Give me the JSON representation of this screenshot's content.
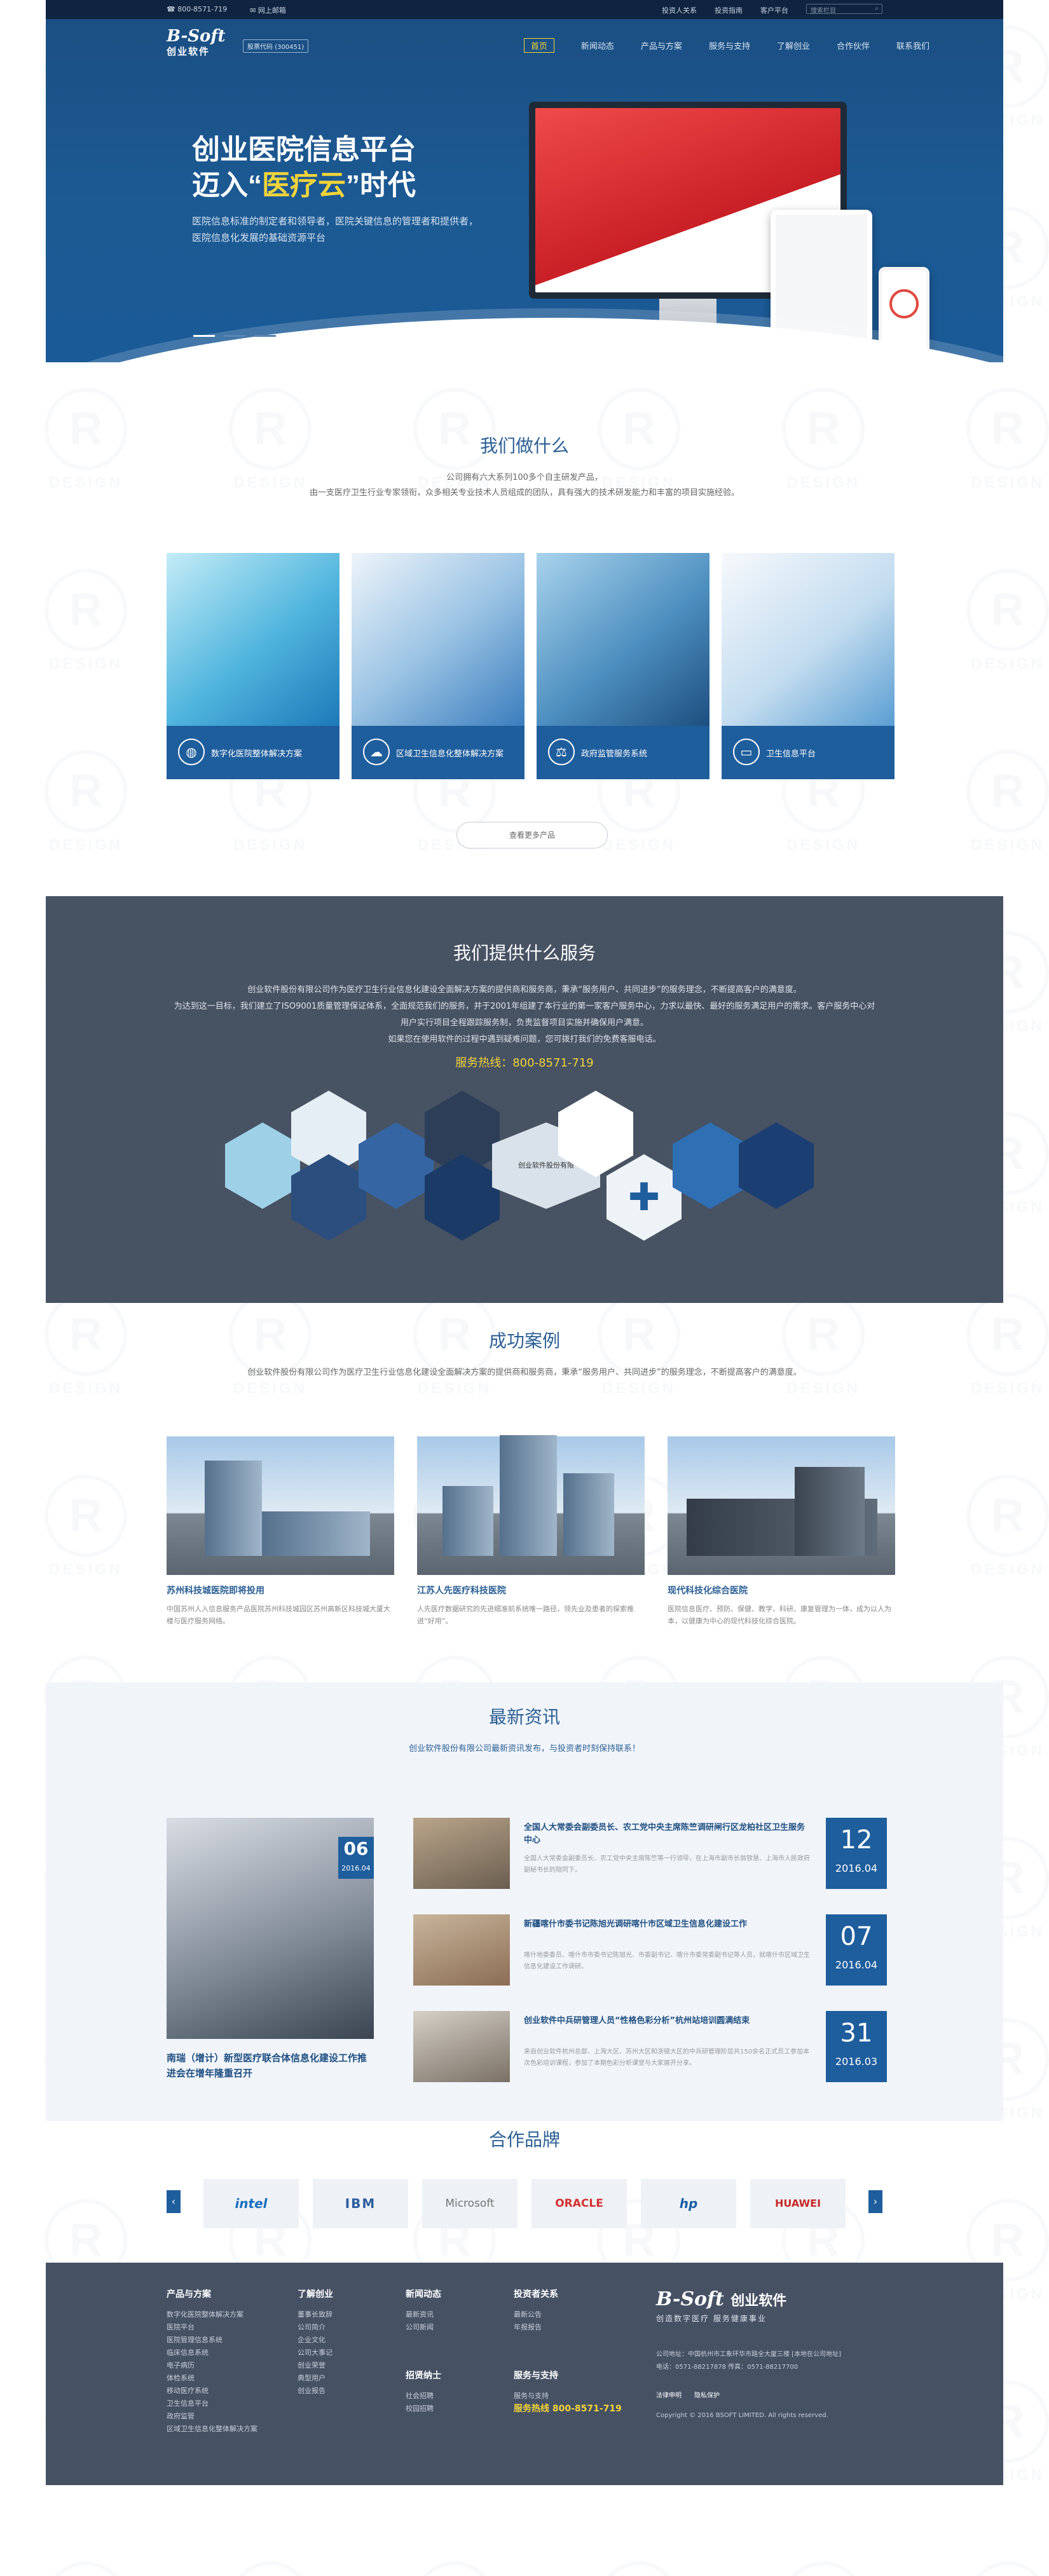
{
  "topbar": {
    "phone": "800-8571-719",
    "webmail": "网上邮箱",
    "links": [
      "投资人关系",
      "投资指南",
      "客户平台"
    ],
    "search_placeholder": "搜索栏目"
  },
  "nav": {
    "logo_script": "B-Soft",
    "logo_cn": "创业软件",
    "stock_code": "股票代码 (300451)",
    "items": [
      "首页",
      "新闻动态",
      "产品与方案",
      "服务与支持",
      "了解创业",
      "合作伙伴",
      "联系我们"
    ]
  },
  "hero": {
    "line1": "创业医院信息平台",
    "line2_pre": "迈入“",
    "line2_hl": "医疗云",
    "line2_post": "”时代",
    "desc": "医院信息标准的制定者和领导者，医院关键信息的管理者和提供者，医院信息化发展的基础资源平台"
  },
  "what_we_do": {
    "title": "我们做什么",
    "sub1": "公司拥有六大系列100多个自主研发产品，",
    "sub2": "由一支医疗卫生行业专家领衔，众多相关专业技术人员组成的团队，具有强大的技术研发能力和丰富的项目实施经验。",
    "products": [
      {
        "label": "数字化医院整体解决方案",
        "icon": "globe-icon"
      },
      {
        "label": "区域卫生信息化整体解决方案",
        "icon": "cloud-plus-icon"
      },
      {
        "label": "政府监管服务系统",
        "icon": "scales-icon"
      },
      {
        "label": "卫生信息平台",
        "icon": "monitor-network-icon"
      }
    ],
    "more_button": "查看更多产品"
  },
  "services": {
    "title": "我们提供什么服务",
    "body1": "创业软件股份有限公司作为医疗卫生行业信息化建设全面解决方案的提供商和服务商，秉承“服务用户、共同进步”的服务理念，不断提高客户的满意度。",
    "body2": "为达到这一目标，我们建立了ISO9001质量管理保证体系，全面规范我们的服务，并于2001年组建了本行业的第一家客户服务中心，力求以最快、最好的服务满足用户的需求。客户服务中心对用户实行项目全程跟踪服务制，负责监督项目实施并确保用户满意。",
    "body3": "如果您在使用软件的过程中遇到疑难问题，您可拨打我们的免费客服电话。",
    "hotline_label": "服务热线：",
    "hotline": "800-8571-719",
    "hex_text": "创业软件股份有限"
  },
  "cases": {
    "title": "成功案例",
    "sub": "创业软件股份有限公司作为医疗卫生行业信息化建设全面解决方案的提供商和服务商，秉承“服务用户、共同进步”的服务理念，不断提高客户的满意度。",
    "items": [
      {
        "title": "苏州科技城医院即将投用",
        "desc": "中国苏州人入信息服务产品医院苏州科技城园区苏州高新区科技城大厦大楼与医疗服务网络。"
      },
      {
        "title": "江苏人先医疗科技医院",
        "desc": "人先医疗数据研究的先进细准前系统唯一路径，领先业及患者的探索推进“好用”。"
      },
      {
        "title": "现代科技化综合医院",
        "desc": "医院信息医疗、预防、保健、教学、科研、康复管理为一体，成为以人为本，以健康为中心的现代科技化综合医院。"
      }
    ]
  },
  "news": {
    "title": "最新资讯",
    "sub": "创业软件股份有限公司最新资讯发布，与投资者时刻保持联系！",
    "main": {
      "day": "06",
      "ym": "2016.04",
      "title": "南瑞（增计）新型医疗联合体信息化建设工作推进会在增年隆重召开"
    },
    "items": [
      {
        "title": "全国人大常委会副委员长、农工党中央主席陈竺调研闸行区龙柏社区卫生服务中心",
        "desc": "全国人大常委会副委员长、农工党中央主席陈竺等一行领导，在上海市副市长翁铁慧、上海市人民政府副秘书长的陪同下。",
        "day": "12",
        "ym": "2016.04"
      },
      {
        "title": "新疆喀什市委书记陈旭光调研喀什市区域卫生信息化建设工作",
        "desc": "喀什地委委员、喀什市市委书记陈旭光、市委副书记、喀什市委常委副书记等人员，就喀什市区域卫生信息化建设工作调研。",
        "day": "07",
        "ym": "2016.04"
      },
      {
        "title": "创业软件中兵研管理人员“性格色彩分析”杭州站培训圆满结束",
        "desc": "来自创业软件杭州总部、上海大区、苏州大区和浙赣大区的中兵研管理阶层共150余名正式员工参加本次色彩培训课程，参加了本期色彩分析课堂与大家展开分享。",
        "day": "31",
        "ym": "2016.03"
      }
    ]
  },
  "partners": {
    "title": "合作品牌",
    "logos": [
      "intel",
      "IBM",
      "Microsoft",
      "ORACLE",
      "hp",
      "HUAWEI"
    ],
    "prev": "‹",
    "next": "›"
  },
  "footer": {
    "cols": [
      {
        "title": "产品与方案",
        "items": [
          "数字化医院整体解决方案",
          "医院平台",
          "医院管理信息系统",
          "临床信息系统",
          "电子病历",
          "体检系统",
          "移动医疗系统",
          "卫生信息平台",
          "政府监管",
          "区域卫生信息化整体解决方案"
        ]
      },
      {
        "title": "了解创业",
        "items": [
          "董事长致辞",
          "公司简介",
          "企业文化",
          "公司大事记",
          "创业荣誉",
          "典型用户",
          "创业报告"
        ]
      },
      {
        "title": "新闻动态",
        "items": [
          "最新资讯",
          "公司新闻"
        ]
      },
      {
        "title": "招贤纳士",
        "items": [
          "社会招聘",
          "校园招聘"
        ]
      },
      {
        "title": "投资者关系",
        "items": [
          "最新公告",
          "年报报告"
        ]
      },
      {
        "title": "服务与支持",
        "items": [
          "服务与支持"
        ]
      }
    ],
    "hotline_label": "服务热线",
    "hotline": "800-8571-719",
    "brand_script": "B-Soft",
    "brand_cn": "创业软件",
    "slogan": "创造数字医疗  服务健康事业",
    "address": "公司地址：中国杭州市工象环华市路全大厦三楼  [本地在公司地址]",
    "phone": "电话：0571-88217878    传真：0571-88217700",
    "links": [
      "法律申明",
      "隐私保护"
    ],
    "copyright": "Copyright © 2016 BSOFT LIMITED. All rights reserved."
  },
  "watermark": {
    "symbol": "R",
    "text": "DESIGN"
  },
  "colors": {
    "primary": "#1f5e9d",
    "accent": "#f2d43a",
    "dark": "#465164",
    "topbar": "#0f2440"
  }
}
